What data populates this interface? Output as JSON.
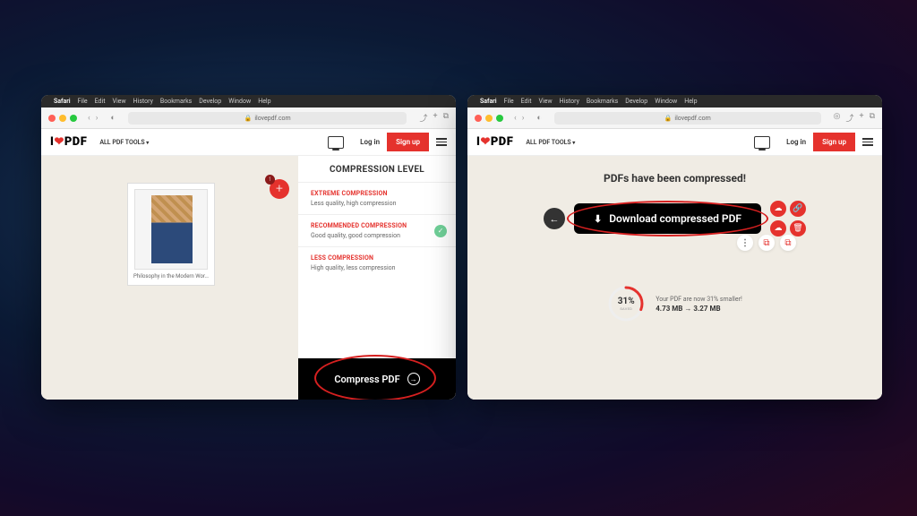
{
  "menubar": {
    "app": "Safari",
    "items": [
      "File",
      "Edit",
      "View",
      "History",
      "Bookmarks",
      "Develop",
      "Window",
      "Help"
    ]
  },
  "toolbar": {
    "url": "ilovepdf.com"
  },
  "header": {
    "logo_pre": "I",
    "logo_post": "PDF",
    "all_tools": "ALL PDF TOOLS",
    "login": "Log in",
    "signup": "Sign up"
  },
  "left": {
    "file_name": "Philosophy in the Modern Worl...",
    "add_badge": "1",
    "panel_title": "COMPRESSION LEVEL",
    "levels": [
      {
        "label": "EXTREME COMPRESSION",
        "desc": "Less quality, high compression",
        "selected": false
      },
      {
        "label": "RECOMMENDED COMPRESSION",
        "desc": "Good quality, good compression",
        "selected": true
      },
      {
        "label": "LESS COMPRESSION",
        "desc": "High quality, less compression",
        "selected": false
      }
    ],
    "compress_btn": "Compress PDF"
  },
  "right": {
    "success": "PDFs have been compressed!",
    "download": "Download compressed PDF",
    "percent": "31%",
    "saved_label": "SAVED",
    "stats_line": "Your PDF are now 31% smaller!",
    "sizes": "4.73 MB → 3.27 MB"
  }
}
